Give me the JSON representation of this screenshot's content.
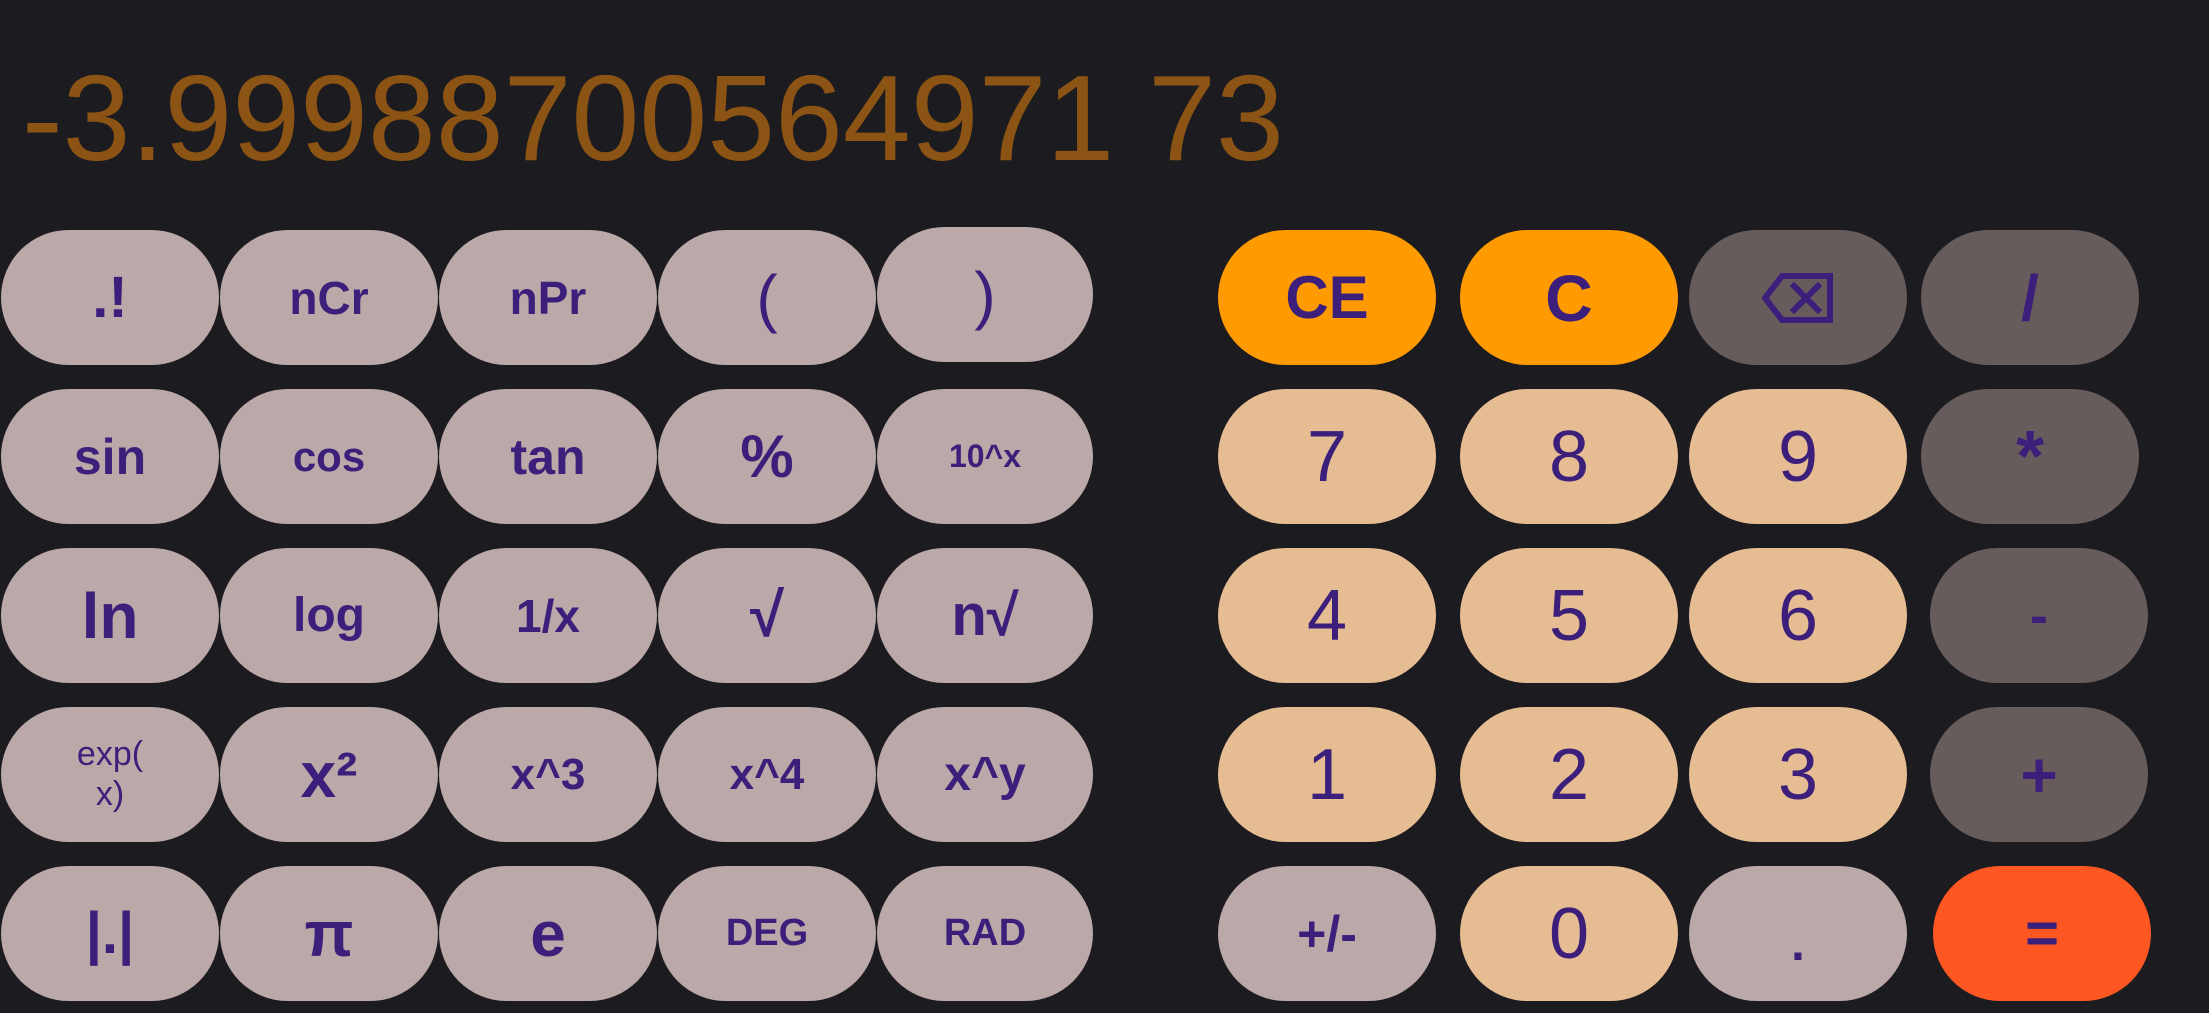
{
  "display": {
    "value": "-3.99988700564971 73"
  },
  "scientific_keys": [
    [
      ".!",
      "nCr",
      "nPr",
      "(",
      ")"
    ],
    [
      "sin",
      "cos",
      "tan",
      "%",
      "10^x"
    ],
    [
      "ln",
      "log",
      "1/x",
      "√",
      "n√"
    ],
    [
      "exp(\nx)",
      "x²",
      "x^3",
      "x^4",
      "x^y"
    ],
    [
      "|.|",
      "π",
      "e",
      "DEG",
      "RAD"
    ]
  ],
  "standard_keys": {
    "clear_entry": "CE",
    "clear": "C",
    "backspace_icon": "backspace-icon",
    "divide": "/",
    "multiply": "*",
    "subtract": "-",
    "add": "+",
    "equals": "=",
    "sign": "+/-",
    "decimal": ".",
    "digits": [
      "0",
      "1",
      "2",
      "3",
      "4",
      "5",
      "6",
      "7",
      "8",
      "9"
    ]
  },
  "colors": {
    "background": "#1c1b1f",
    "display_text": "#8c5414",
    "key_text": "#3b1f7a",
    "scientific_key": "#bba8a8",
    "number_key": "#e6bc93",
    "operator_key": "#665c5c",
    "clear_key": "#ff9a00",
    "equals_key": "#ff5722"
  }
}
